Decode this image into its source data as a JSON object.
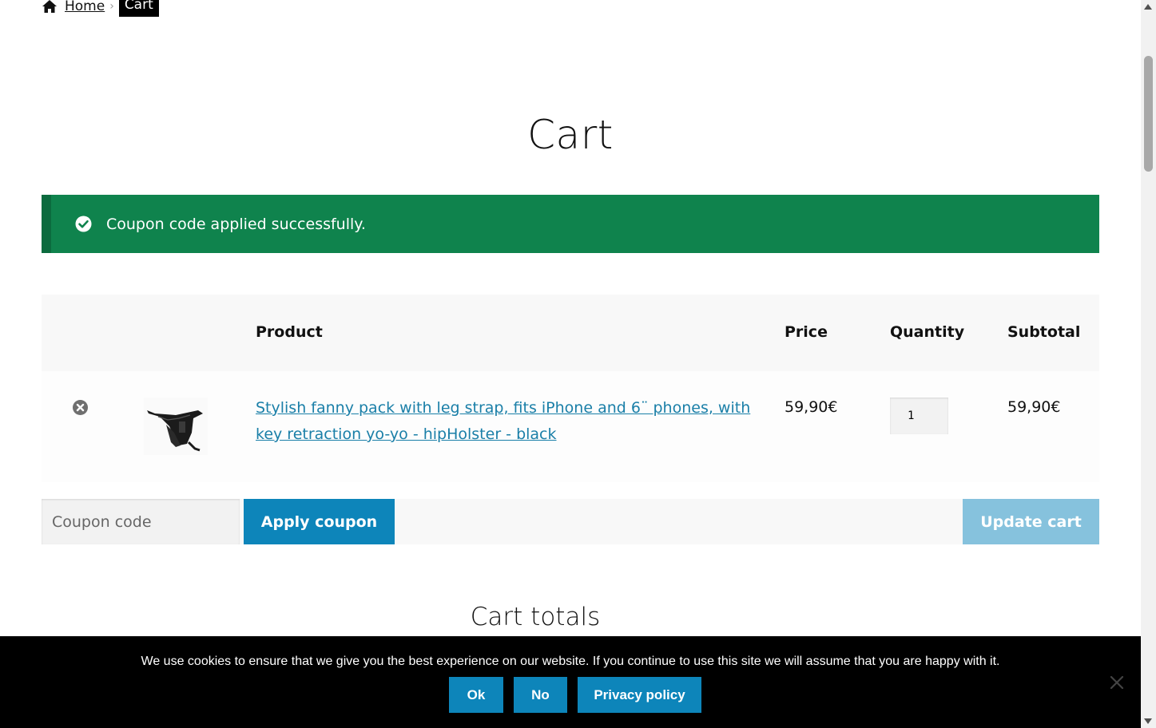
{
  "breadcrumb": {
    "home_icon": "home-icon",
    "home_label": "Home",
    "separator": "›",
    "current": "Cart"
  },
  "page": {
    "title": "Cart"
  },
  "notice": {
    "icon": "check-circle-icon",
    "message": "Coupon code applied successfully.",
    "color": "#0f834d"
  },
  "cart_table": {
    "headers": {
      "product": "Product",
      "price": "Price",
      "quantity": "Quantity",
      "subtotal": "Subtotal"
    },
    "items": [
      {
        "remove_icon": "remove-circle-icon",
        "thumbnail": "fanny-pack-thumbnail",
        "name": "Stylish fanny pack with leg strap, fits iPhone and 6¨ phones, with key retraction yo-yo - hipHolster - black",
        "price": "59,90€",
        "quantity": "1",
        "subtotal": "59,90€"
      }
    ]
  },
  "actions": {
    "coupon_placeholder": "Coupon code",
    "apply_label": "Apply coupon",
    "update_label": "Update cart",
    "accent": "#0d85ba"
  },
  "totals": {
    "title": "Cart totals"
  },
  "cookie": {
    "text": "We use cookies to ensure that we give you the best experience on our website. If you continue to use this site we will assume that you are happy with it.",
    "ok_label": "Ok",
    "no_label": "No",
    "policy_label": "Privacy policy",
    "close_icon": "close-icon"
  }
}
